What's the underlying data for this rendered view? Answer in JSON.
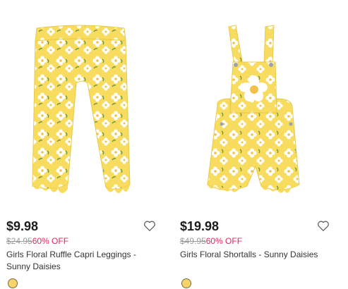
{
  "products": [
    {
      "price": "$9.98",
      "original_price": "$24.95",
      "discount": "60% OFF",
      "title": "Girls Floral Ruffle Capri Leggings - Sunny Daisies",
      "swatch_color": "#f6d36b",
      "image_subject": "leggings",
      "wishlist_icon": "heart-outline-icon"
    },
    {
      "price": "$19.98",
      "original_price": "$49.95",
      "discount": "60% OFF",
      "title": "Girls Floral Shortalls - Sunny Daisies",
      "swatch_color": "#f6d36b",
      "image_subject": "shortalls",
      "wishlist_icon": "heart-outline-icon"
    }
  ],
  "colors": {
    "fabric": "#f7dc5f",
    "daisy": "#ffffff",
    "daisy_center": "#f2c14a",
    "leaf": "#6f9a3f",
    "sale": "#e0285a"
  }
}
